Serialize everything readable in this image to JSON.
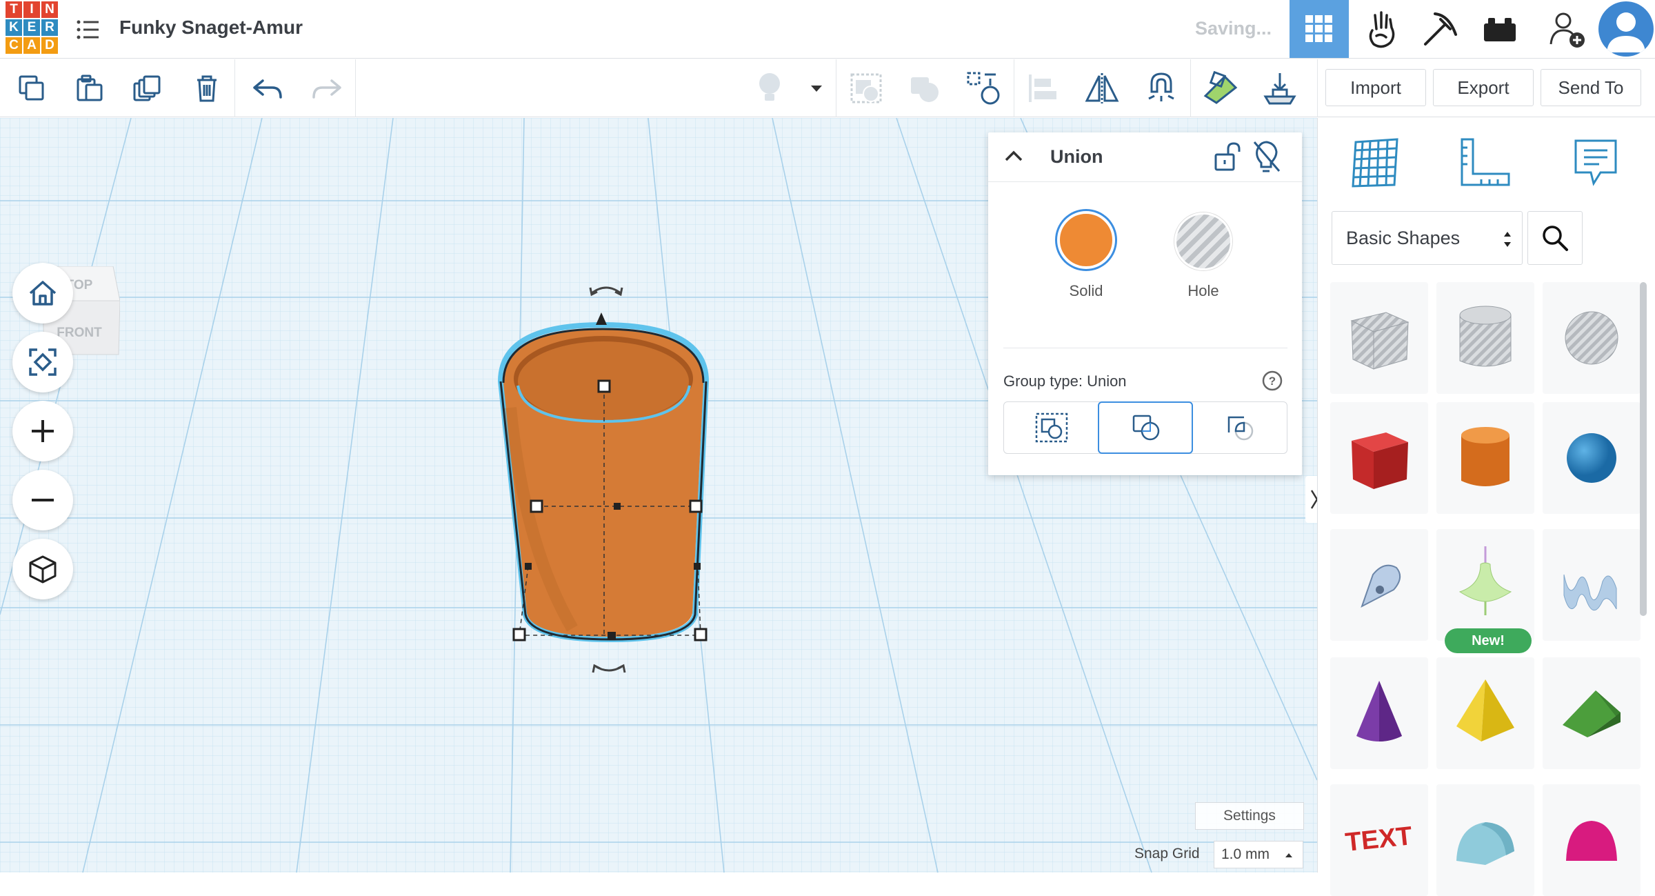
{
  "app": {
    "logo_letters": [
      "T",
      "I",
      "N",
      "K",
      "E",
      "R",
      "C",
      "A",
      "D"
    ],
    "logo_colors": [
      "#e2442f",
      "#e2442f",
      "#e2442f",
      "#2e8bc0",
      "#2e8bc0",
      "#2e8bc0",
      "#f39c12",
      "#f39c12",
      "#f39c12"
    ],
    "project_title": "Funky Snaget-Amur",
    "status": "Saving..."
  },
  "topbar": {
    "icons": [
      "3d-design-grid-icon",
      "circuits-hand-icon",
      "codeblocks-pickaxe-icon",
      "bricks-icon",
      "invite-user-icon",
      "user-avatar"
    ]
  },
  "toolbar": {
    "left_icons": [
      "copy-icon",
      "paste-icon",
      "duplicate-icon",
      "delete-icon",
      "undo-icon",
      "redo-icon"
    ],
    "right_icons": [
      "light-bulb-icon",
      "dropdown-icon",
      "group-icon",
      "solid-group-icon",
      "hole-grid-icon",
      "align-icon",
      "mirror-icon",
      "magnet-icon",
      "workplane-icon",
      "drop-to-plane-icon"
    ],
    "import_label": "Import",
    "export_label": "Export",
    "send_label": "Send To"
  },
  "viewcube": {
    "top_label": "TOP",
    "front_label": "FRONT"
  },
  "inspector": {
    "title": "Union",
    "solid_label": "Solid",
    "hole_label": "Hole",
    "solid_color": "#ee8a34",
    "group_type_label": "Group type: Union",
    "selected_group_type": "union"
  },
  "workplane": {
    "settings_label": "Settings",
    "snap_label": "Snap Grid",
    "snap_value": "1.0 mm",
    "shape_color": "#d67a34"
  },
  "library": {
    "selected": "Basic Shapes",
    "new_badge": "New!",
    "shapes": [
      "box-hole",
      "cylinder-hole",
      "sphere-hole",
      "box",
      "cylinder",
      "sphere",
      "scribble",
      "spinner",
      "text-squiggle",
      "cone",
      "pyramid",
      "roof",
      "text",
      "half-cylinder",
      "paraboloid"
    ]
  }
}
